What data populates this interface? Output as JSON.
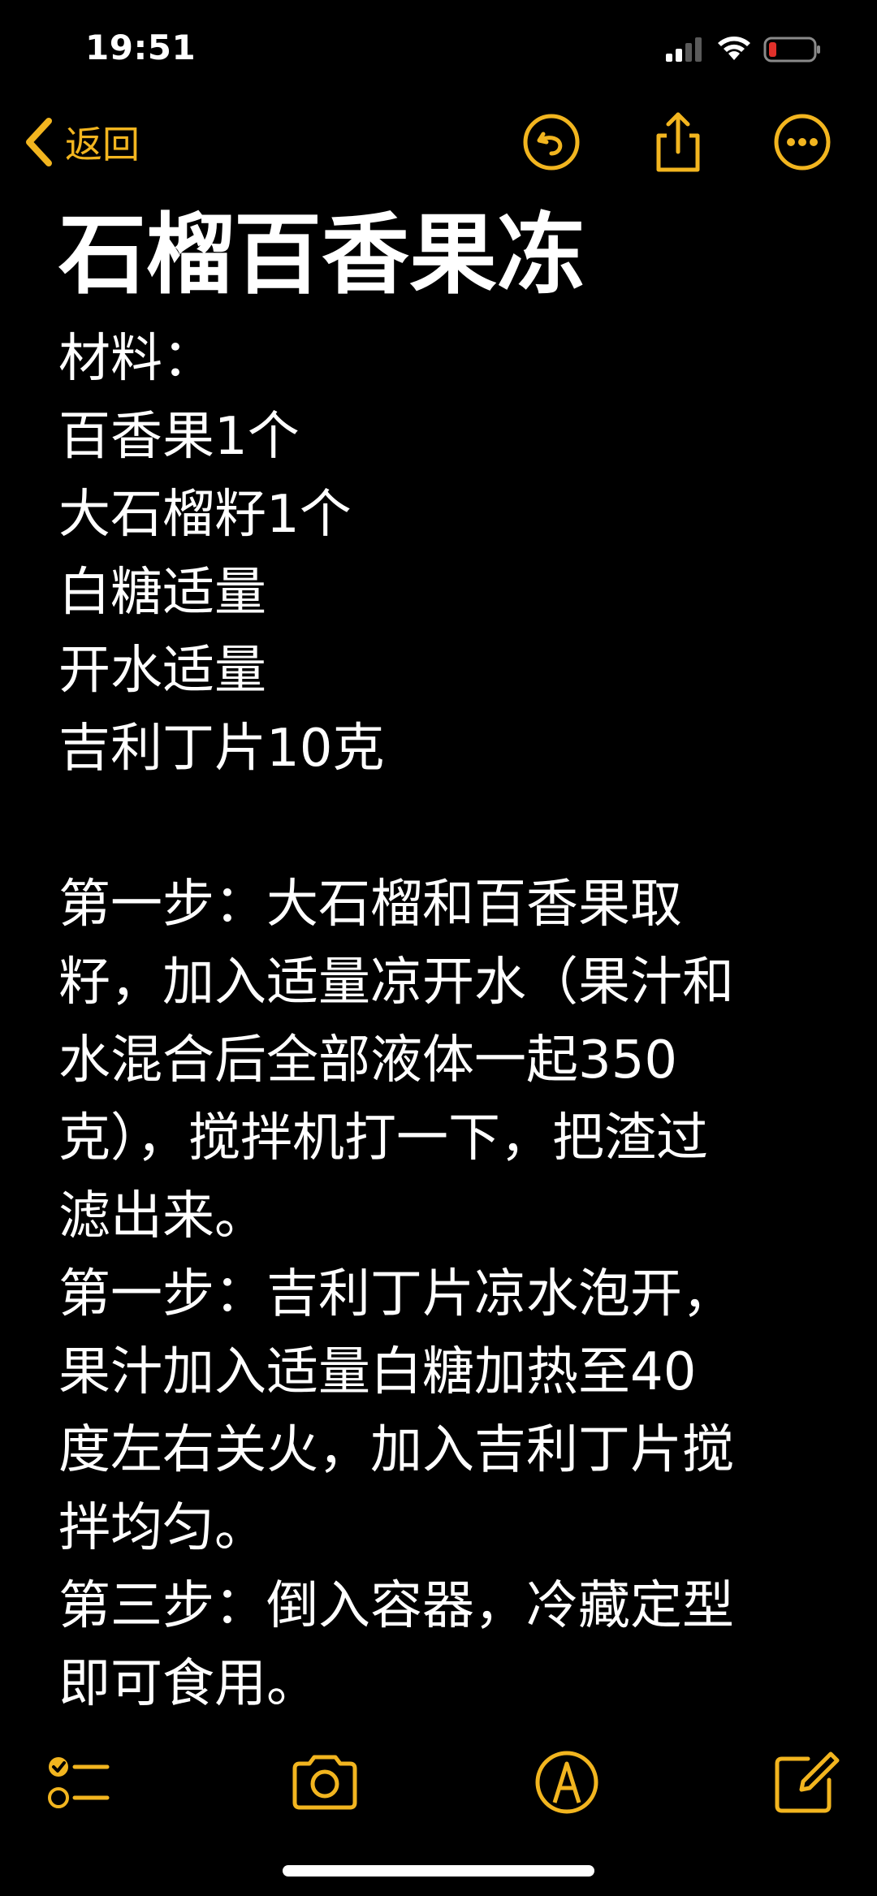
{
  "status_bar": {
    "time": "19:51"
  },
  "nav": {
    "back_label": "返回",
    "icons": [
      "chevron-left-icon",
      "undo-icon",
      "share-icon",
      "more-icon"
    ]
  },
  "colors": {
    "accent": "#f2b51f",
    "background": "#000000",
    "text": "#ffffff",
    "battery_low": "#e0302a"
  },
  "note": {
    "title": "石榴百香果冻",
    "lines": [
      "材料：",
      "百香果1个",
      "大石榴籽1个",
      "白糖适量",
      "开水适量",
      "吉利丁片10克",
      "",
      "第一步：大石榴和百香果取",
      "籽，加入适量凉开水（果汁和",
      "水混合后全部液体一起350",
      "克），搅拌机打一下，把渣过",
      "滤出来。",
      "第一步：吉利丁片凉水泡开，",
      "果汁加入适量白糖加热至40",
      "度左右关火，加入吉利丁片搅",
      "拌均匀。",
      "第三步：倒入容器，冷藏定型",
      "即可食用。"
    ]
  },
  "toolbar": {
    "icons": [
      "checklist-icon",
      "camera-icon",
      "markup-pen-icon",
      "compose-icon"
    ]
  }
}
